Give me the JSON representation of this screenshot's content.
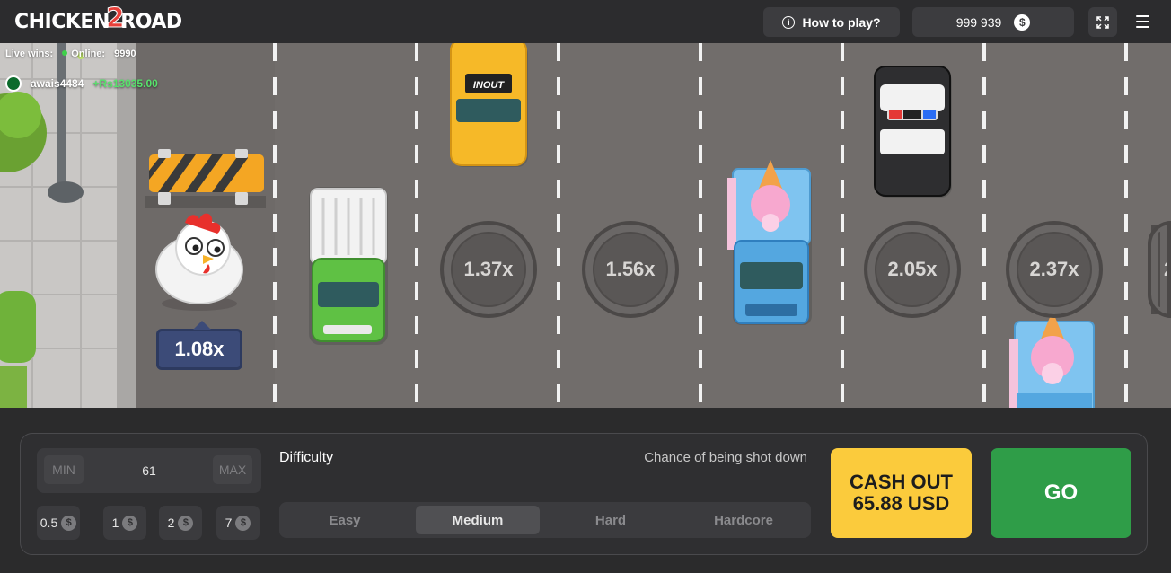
{
  "header": {
    "logo_text_a": "CHICKEN",
    "logo_text_num": "2",
    "logo_text_b": "ROAD",
    "how_to_play": "How to play?",
    "balance": "999 939",
    "currency_symbol": "$"
  },
  "live": {
    "live_wins_label": "Live wins:",
    "online_label": "Online:",
    "online_count": "9990",
    "user_name": "awais4484",
    "user_win": "+Rs13035.00"
  },
  "game": {
    "current_multiplier": "1.08x",
    "lane_multipliers": [
      "1.37x",
      "1.56x",
      "2.05x",
      "2.37x",
      "2"
    ],
    "taxi_sign": "INOUT"
  },
  "panel": {
    "min_label": "MIN",
    "max_label": "MAX",
    "bet_value": "61",
    "chips": [
      "0.5",
      "1",
      "2",
      "7"
    ],
    "difficulty_label": "Difficulty",
    "chance_label": "Chance of being shot down",
    "difficulties": [
      "Easy",
      "Medium",
      "Hard",
      "Hardcore"
    ],
    "active_difficulty": "Medium",
    "cashout_line1": "CASH OUT",
    "cashout_line2": "65.88 USD",
    "go_label": "GO"
  },
  "colors": {
    "cashout": "#fbcb3c",
    "go": "#2f9d48",
    "win_green": "#56e26b",
    "badge": "#3c4b78"
  }
}
